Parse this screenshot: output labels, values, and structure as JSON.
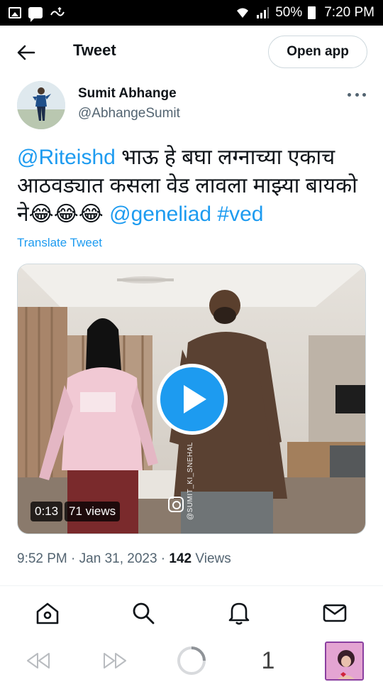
{
  "status_bar": {
    "battery": "50%",
    "time": "7:20 PM"
  },
  "header": {
    "title": "Tweet",
    "open_app_label": "Open app"
  },
  "author": {
    "name": "Sumit Abhange",
    "handle": "@AbhangeSumit"
  },
  "tweet": {
    "mention_1": "@Riteishd",
    "text_body": " भाऊ हे बघा लग्नाच्या एकाच आठवड्यात कसला वेड लावला माझ्या बायको ने",
    "emojis": "😂😂😂",
    "mention_2": "@geneliad",
    "hashtag": "#ved",
    "translate_label": "Translate Tweet"
  },
  "media": {
    "duration": "0:13",
    "views": "71 views",
    "watermark": "@SUMIT_KI_SNEHAL"
  },
  "meta": {
    "time": "9:52 PM",
    "separator_1": " · ",
    "date": "Jan 31, 2023",
    "separator_2": " · ",
    "view_count": "142",
    "views_label": " Views"
  },
  "browser": {
    "tab_count": "1"
  },
  "colors": {
    "accent": "#1d9bf0",
    "text": "#0f1419",
    "secondary": "#536471"
  }
}
